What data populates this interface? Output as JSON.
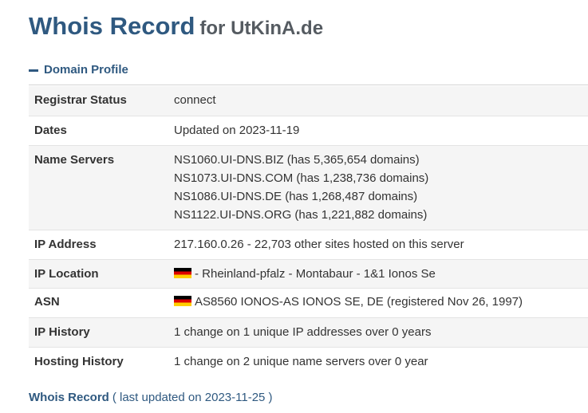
{
  "header": {
    "title_main": "Whois Record",
    "title_sub": "for UtKinA.de"
  },
  "section": {
    "label": "Domain Profile"
  },
  "rows": {
    "registrar_status": {
      "label": "Registrar Status",
      "value": "connect"
    },
    "dates": {
      "label": "Dates",
      "value": "Updated on 2023-11-19"
    },
    "name_servers": {
      "label": "Name Servers",
      "values": [
        "NS1060.UI-DNS.BIZ (has 5,365,654 domains)",
        "NS1073.UI-DNS.COM (has 1,238,736 domains)",
        "NS1086.UI-DNS.DE (has 1,268,487 domains)",
        "NS1122.UI-DNS.ORG (has 1,221,882 domains)"
      ]
    },
    "ip_address": {
      "label": "IP Address",
      "value": "217.160.0.26 - 22,703 other sites hosted on this server"
    },
    "ip_location": {
      "label": "IP Location",
      "value": "- Rheinland-pfalz - Montabaur - 1&1 Ionos Se",
      "flag_icon": "germany-flag-icon"
    },
    "asn": {
      "label": "ASN",
      "value": "AS8560 IONOS-AS IONOS SE, DE (registered Nov 26, 1997)",
      "flag_icon": "germany-flag-icon"
    },
    "ip_history": {
      "label": "IP History",
      "value": "1 change on 1 unique IP addresses over 0 years"
    },
    "hosting_history": {
      "label": "Hosting History",
      "value": "1 change on 2 unique name servers over 0 year"
    }
  },
  "footer": {
    "link": "Whois Record",
    "note": "( last updated on 2023-11-25 )"
  },
  "colors": {
    "heading_blue": "#2f5980",
    "subtitle_gray": "#555b61",
    "row_shade": "#f5f5f5"
  }
}
